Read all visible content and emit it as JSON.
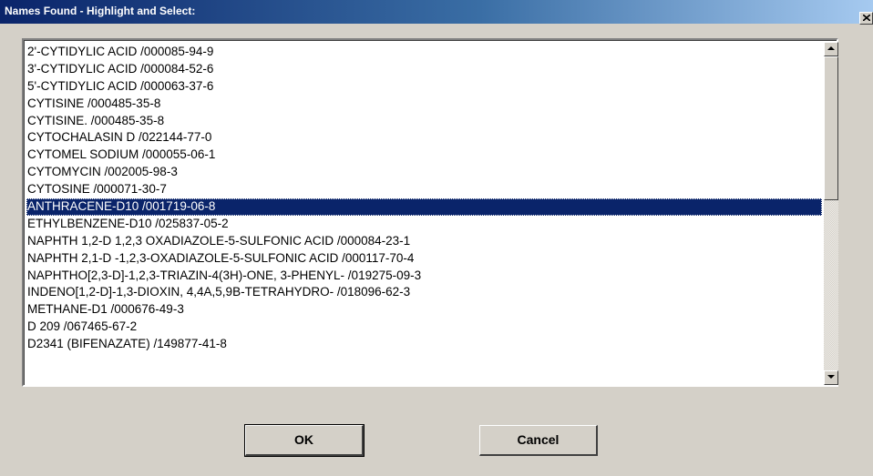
{
  "window": {
    "title": "Names Found - Highlight and Select:",
    "close_icon": "close-x-icon"
  },
  "list": {
    "selected_index": 9,
    "items": [
      "2'-CYTIDYLIC ACID /000085-94-9",
      "3'-CYTIDYLIC ACID /000084-52-6",
      "5'-CYTIDYLIC ACID /000063-37-6",
      "CYTISINE /000485-35-8",
      "CYTISINE. /000485-35-8",
      "CYTOCHALASIN D /022144-77-0",
      "CYTOMEL SODIUM /000055-06-1",
      "CYTOMYCIN /002005-98-3",
      "CYTOSINE /000071-30-7",
      "ANTHRACENE-D10 /001719-06-8",
      "ETHYLBENZENE-D10 /025837-05-2",
      "NAPHTH 1,2-D  1,2,3 OXADIAZOLE-5-SULFONIC ACID /000084-23-1",
      "NAPHTH 2,1-D -1,2,3-OXADIAZOLE-5-SULFONIC ACID /000117-70-4",
      "NAPHTHO[2,3-D]-1,2,3-TRIAZIN-4(3H)-ONE, 3-PHENYL- /019275-09-3",
      "INDENO[1,2-D]-1,3-DIOXIN, 4,4A,5,9B-TETRAHYDRO- /018096-62-3",
      "METHANE-D1 /000676-49-3",
      "D 209 /067465-67-2",
      "D2341 (BIFENAZATE) /149877-41-8"
    ]
  },
  "scrollbar": {
    "up_icon": "scroll-up-arrow-icon",
    "down_icon": "scroll-down-arrow-icon",
    "thumb_position_fraction": 0.0,
    "visible_fraction": 0.45
  },
  "buttons": {
    "ok_label": "OK",
    "cancel_label": "Cancel"
  },
  "colors": {
    "selection_background": "#0a246a",
    "selection_text": "#ffffff",
    "dialog_background": "#d4d0c8",
    "titlebar_start": "#0a246a",
    "titlebar_end": "#a6caf0"
  }
}
